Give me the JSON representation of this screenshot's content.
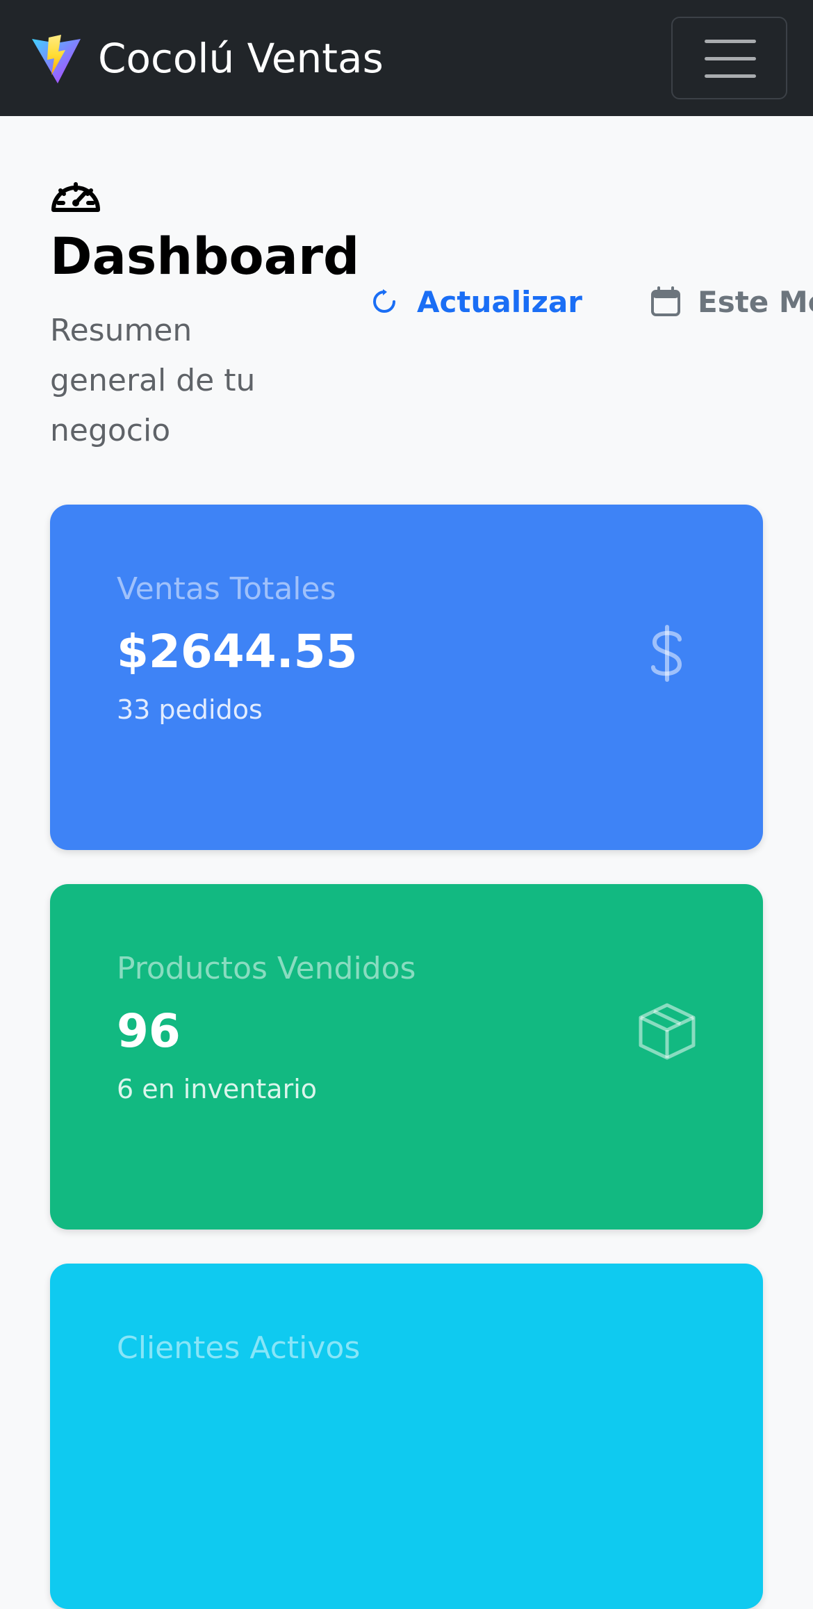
{
  "navbar": {
    "brand": "Cocolú Ventas",
    "logo_icon": "vite-bolt-logo",
    "menu_icon": "hamburger-menu-icon"
  },
  "header": {
    "icon": "speedometer-icon",
    "title": "Dashboard",
    "subtitle": "Resumen general de tu negocio",
    "refresh_label": "Actualizar",
    "period_label": "Este Mes"
  },
  "cards": [
    {
      "label": "Ventas Totales",
      "value": "$2644.55",
      "sub": "33 pedidos",
      "icon": "dollar-icon",
      "color": "#3e83f6"
    },
    {
      "label": "Productos Vendidos",
      "value": "96",
      "sub": "6 en inventario",
      "icon": "box-icon",
      "color": "#12b981"
    },
    {
      "label": "Clientes Activos",
      "icon": "users-icon",
      "color": "#0fcaf0"
    }
  ],
  "colors": {
    "navbar": "#212529",
    "accent": "#1a6ef5",
    "muted": "#6c757d"
  }
}
